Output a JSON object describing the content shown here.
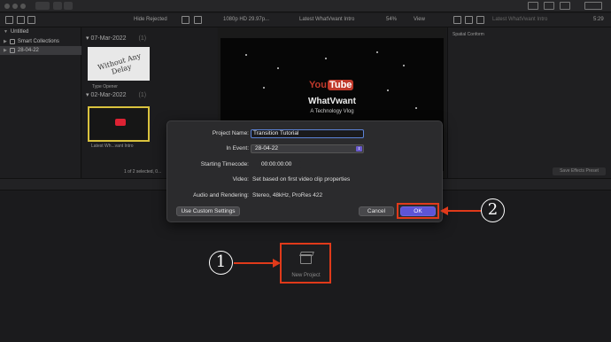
{
  "toolbar": {
    "hide_rejected": "Hide Rejected",
    "format": "1080p HD 29.97p...",
    "viewer_title": "Latest WhatVwant Intro",
    "zoom": "54%",
    "view": "View",
    "inspector_name": "Latest WhatVwant Intro",
    "duration": "5:29"
  },
  "sidebar": {
    "items": [
      {
        "label": "Untitled"
      },
      {
        "label": "Smart Collections"
      },
      {
        "label": "28-04-22"
      }
    ]
  },
  "browser": {
    "groups": [
      {
        "date": "07-Mar-2022",
        "count": "(1)",
        "clip_label": "Type Opener",
        "clip_text": "Without Any Delay"
      },
      {
        "date": "02-Mar-2022",
        "count": "(1)",
        "clip_label": "Latest Wh...vant Intro"
      }
    ],
    "selection_status": "1 of 2 selected, 0..."
  },
  "viewer": {
    "yt_you": "You",
    "yt_tube": "Tube",
    "brand": "WhatVwant",
    "tagline": "A Technology Vlog"
  },
  "inspector": {
    "title": "Spatial Conform",
    "save_button": "Save Effects Preset"
  },
  "dialog": {
    "project_name_label": "Project Name:",
    "project_name_value": "Transition Tutorial",
    "in_event_label": "In Event:",
    "in_event_value": "28-04-22",
    "starting_timecode_label": "Starting Timecode:",
    "starting_timecode_value": "00:00:00:00",
    "video_label": "Video:",
    "video_value": "Set based on first video clip properties",
    "audio_label": "Audio and Rendering:",
    "audio_value": "Stereo, 48kHz, ProRes 422",
    "custom_button": "Use Custom Settings",
    "cancel_button": "Cancel",
    "ok_button": "OK"
  },
  "new_project": {
    "label": "New Project"
  },
  "annotations": {
    "step1": "1",
    "step2": "2",
    "accent_color": "#e03a1a"
  }
}
